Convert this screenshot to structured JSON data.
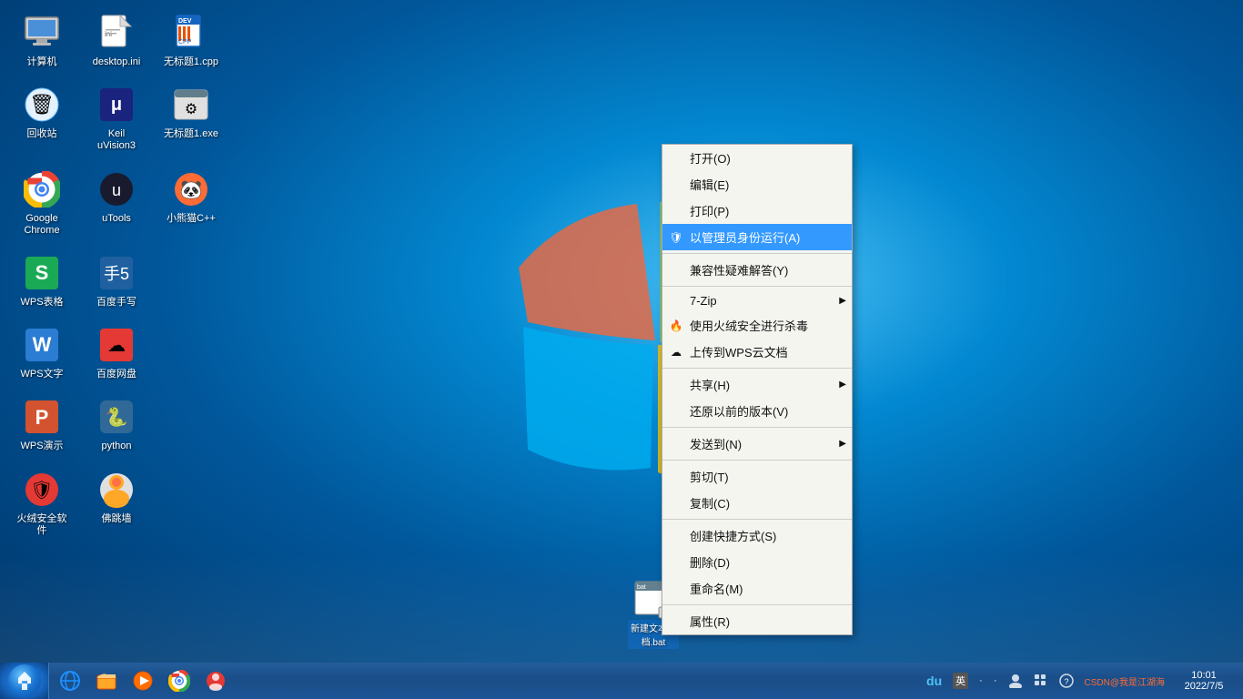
{
  "desktop": {
    "background": "blue gradient Windows 7"
  },
  "icons": {
    "row1": [
      {
        "id": "computer",
        "label": "计算机",
        "emoji": "🖥"
      },
      {
        "id": "desktop-ini",
        "label": "desktop.ini",
        "emoji": "📄"
      },
      {
        "id": "cpp-file",
        "label": "无标题1.cpp",
        "emoji": "📝"
      }
    ],
    "row2": [
      {
        "id": "recycle",
        "label": "回收站",
        "emoji": "🗑"
      },
      {
        "id": "keil",
        "label": "Keil\nuVision3",
        "emoji": "🔧"
      },
      {
        "id": "exe-file",
        "label": "无标题1.exe",
        "emoji": "⚙"
      }
    ],
    "row3": [
      {
        "id": "chrome",
        "label": "Google\nChrome",
        "emoji": "🌐"
      },
      {
        "id": "utools",
        "label": "uTools",
        "emoji": "🔨"
      },
      {
        "id": "xiaoxiong",
        "label": "小熊猫C++",
        "emoji": "🐼"
      }
    ],
    "row4": [
      {
        "id": "wps-table",
        "label": "WPS表格",
        "emoji": "📊"
      },
      {
        "id": "baidu-input",
        "label": "百度手写",
        "emoji": "✏"
      }
    ],
    "row5": [
      {
        "id": "wps-word",
        "label": "WPS文字",
        "emoji": "📝"
      },
      {
        "id": "baidu-cloud",
        "label": "百度网盘",
        "emoji": "☁"
      }
    ],
    "row6": [
      {
        "id": "wps-ppt",
        "label": "WPS演示",
        "emoji": "📽"
      },
      {
        "id": "python",
        "label": "python",
        "emoji": "🐍"
      }
    ],
    "row7": [
      {
        "id": "fire-safety",
        "label": "火绒安全软件",
        "emoji": "🛡"
      },
      {
        "id": "buddha",
        "label": "佛跳墙",
        "emoji": "🌐"
      }
    ]
  },
  "bat_icon": {
    "label": "新建文本文\n档.bat",
    "emoji": "⚙"
  },
  "context_menu": {
    "items": [
      {
        "id": "open",
        "label": "打开(O)",
        "icon": "",
        "has_submenu": false,
        "highlighted": false
      },
      {
        "id": "edit",
        "label": "编辑(E)",
        "icon": "",
        "has_submenu": false,
        "highlighted": false
      },
      {
        "id": "print",
        "label": "打印(P)",
        "icon": "",
        "has_submenu": false,
        "highlighted": false
      },
      {
        "id": "run-as-admin",
        "label": "以管理员身份运行(A)",
        "icon": "🛡",
        "has_submenu": false,
        "highlighted": true
      },
      {
        "id": "sep1",
        "label": "",
        "type": "separator"
      },
      {
        "id": "compat",
        "label": "兼容性疑难解答(Y)",
        "icon": "",
        "has_submenu": false,
        "highlighted": false
      },
      {
        "id": "sep2",
        "label": "",
        "type": "separator"
      },
      {
        "id": "7zip",
        "label": "7-Zip",
        "icon": "",
        "has_submenu": true,
        "highlighted": false
      },
      {
        "id": "antivirus",
        "label": "使用火绒安全进行杀毒",
        "icon": "🔥",
        "has_submenu": false,
        "highlighted": false
      },
      {
        "id": "wps-upload",
        "label": "上传到WPS云文档",
        "icon": "☁",
        "has_submenu": false,
        "highlighted": false
      },
      {
        "id": "sep3",
        "label": "",
        "type": "separator"
      },
      {
        "id": "share",
        "label": "共享(H)",
        "icon": "",
        "has_submenu": true,
        "highlighted": false
      },
      {
        "id": "restore",
        "label": "还原以前的版本(V)",
        "icon": "",
        "has_submenu": false,
        "highlighted": false
      },
      {
        "id": "sep4",
        "label": "",
        "type": "separator"
      },
      {
        "id": "sendto",
        "label": "发送到(N)",
        "icon": "",
        "has_submenu": true,
        "highlighted": false
      },
      {
        "id": "sep5",
        "label": "",
        "type": "separator"
      },
      {
        "id": "cut",
        "label": "剪切(T)",
        "icon": "",
        "has_submenu": false,
        "highlighted": false
      },
      {
        "id": "copy",
        "label": "复制(C)",
        "icon": "",
        "has_submenu": false,
        "highlighted": false
      },
      {
        "id": "sep6",
        "label": "",
        "type": "separator"
      },
      {
        "id": "create-shortcut",
        "label": "创建快捷方式(S)",
        "icon": "",
        "has_submenu": false,
        "highlighted": false
      },
      {
        "id": "delete",
        "label": "删除(D)",
        "icon": "",
        "has_submenu": false,
        "highlighted": false
      },
      {
        "id": "rename",
        "label": "重命名(M)",
        "icon": "",
        "has_submenu": false,
        "highlighted": false
      },
      {
        "id": "sep7",
        "label": "",
        "type": "separator"
      },
      {
        "id": "properties",
        "label": "属性(R)",
        "icon": "",
        "has_submenu": false,
        "highlighted": false
      }
    ]
  },
  "taskbar": {
    "start_label": "",
    "icons": [
      {
        "id": "ie",
        "emoji": "🌐"
      },
      {
        "id": "explorer",
        "emoji": "📁"
      },
      {
        "id": "media",
        "emoji": "▶"
      },
      {
        "id": "chrome-task",
        "emoji": "🌐"
      },
      {
        "id": "vpn",
        "emoji": "🔗"
      }
    ]
  },
  "system_tray": {
    "du_label": "du",
    "input_label": "英",
    "dot1": "·",
    "dot2": "·",
    "csdn_label": "CSDN@我是江湖海",
    "time": "10:01",
    "date": "2022/7/5"
  }
}
